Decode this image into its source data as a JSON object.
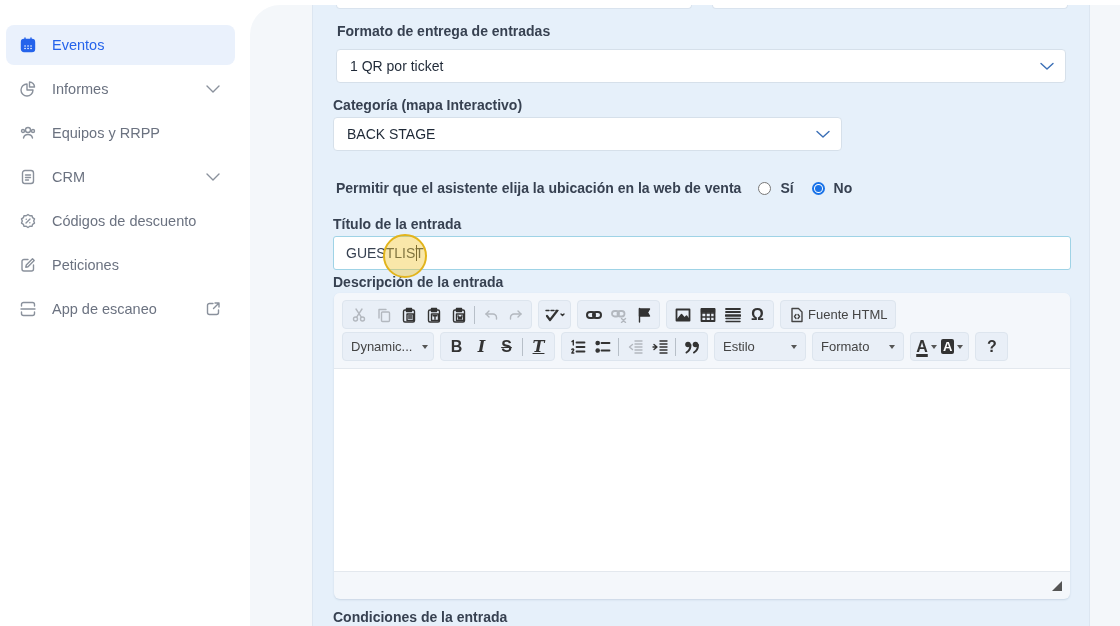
{
  "sidebar": {
    "items": [
      {
        "label": "Eventos",
        "kind": "link",
        "selected": true
      },
      {
        "label": "Informes",
        "kind": "group",
        "expanded": false,
        "selected": false
      },
      {
        "label": "Equipos y RRPP",
        "kind": "link",
        "selected": false
      },
      {
        "label": "CRM",
        "kind": "group",
        "expanded": false,
        "selected": false
      },
      {
        "label": "Códigos de descuento",
        "kind": "link",
        "selected": false
      },
      {
        "label": "Peticiones",
        "kind": "link",
        "selected": false
      },
      {
        "label": "App de escaneo",
        "kind": "external",
        "selected": false
      }
    ]
  },
  "form": {
    "delivery_format": {
      "label": "Formato de entrega de entradas",
      "value": "1 QR por ticket"
    },
    "category": {
      "label": "Categoría (mapa Interactivo)",
      "value": "BACK STAGE"
    },
    "seat_choice": {
      "label": "Permitir que el asistente elija la ubicación en la web de venta",
      "options": [
        {
          "label": "Sí",
          "selected": false
        },
        {
          "label": "No",
          "selected": true
        }
      ]
    },
    "title_field": {
      "label": "Título de la entrada",
      "value": "GUESTLIST"
    },
    "description": {
      "label": "Descripción de la entrada",
      "toolbar_rows": [
        {
          "groups": [
            {
              "items": [
                {
                  "kind": "cut",
                  "disabled": true
                },
                {
                  "kind": "copy",
                  "disabled": true
                },
                {
                  "kind": "paste",
                  "disabled": false
                },
                {
                  "kind": "paste-text",
                  "disabled": false
                },
                {
                  "kind": "paste-word",
                  "disabled": false
                },
                {
                  "kind": "sep"
                },
                {
                  "kind": "undo",
                  "disabled": true
                },
                {
                  "kind": "redo",
                  "disabled": true
                }
              ]
            },
            {
              "items": [
                {
                  "kind": "spell",
                  "disabled": false
                }
              ]
            },
            {
              "items": [
                {
                  "kind": "link",
                  "disabled": false
                },
                {
                  "kind": "unlink",
                  "disabled": true
                },
                {
                  "kind": "anchor",
                  "disabled": false
                }
              ]
            },
            {
              "items": [
                {
                  "kind": "image",
                  "disabled": false
                },
                {
                  "kind": "table",
                  "disabled": false
                },
                {
                  "kind": "hr",
                  "disabled": false
                },
                {
                  "kind": "glyph",
                  "label": "Ω",
                  "disabled": false
                }
              ]
            },
            {
              "items": [
                {
                  "kind": "source",
                  "label": "Fuente HTML",
                  "disabled": false
                }
              ]
            }
          ]
        },
        {
          "groups": [
            {
              "items": [
                {
                  "kind": "combo",
                  "label": "Dynamic..."
                }
              ]
            },
            {
              "items": [
                {
                  "kind": "glyph",
                  "label": "B",
                  "disabled": false
                },
                {
                  "kind": "italic",
                  "label": "I",
                  "disabled": false
                },
                {
                  "kind": "strike",
                  "label": "S",
                  "disabled": false
                },
                {
                  "kind": "sep"
                },
                {
                  "kind": "removeformat",
                  "label": "T",
                  "disabled": false
                }
              ]
            },
            {
              "items": [
                {
                  "kind": "ol",
                  "disabled": false
                },
                {
                  "kind": "ul",
                  "disabled": false
                },
                {
                  "kind": "sep"
                },
                {
                  "kind": "outdent",
                  "disabled": true
                },
                {
                  "kind": "indent",
                  "disabled": false
                },
                {
                  "kind": "sep"
                },
                {
                  "kind": "quote",
                  "disabled": false
                }
              ]
            },
            {
              "items": [
                {
                  "kind": "combo",
                  "label": "Estilo"
                }
              ]
            },
            {
              "items": [
                {
                  "kind": "combo",
                  "label": "Formato"
                }
              ]
            },
            {
              "items": [
                {
                  "kind": "textcolor",
                  "label": "A",
                  "disabled": false
                },
                {
                  "kind": "bgcolor",
                  "label": "A",
                  "disabled": false
                }
              ]
            },
            {
              "items": [
                {
                  "kind": "glyph",
                  "label": "?",
                  "disabled": false
                }
              ]
            }
          ]
        }
      ]
    },
    "conditions": {
      "label": "Condiciones de la entrada"
    }
  }
}
